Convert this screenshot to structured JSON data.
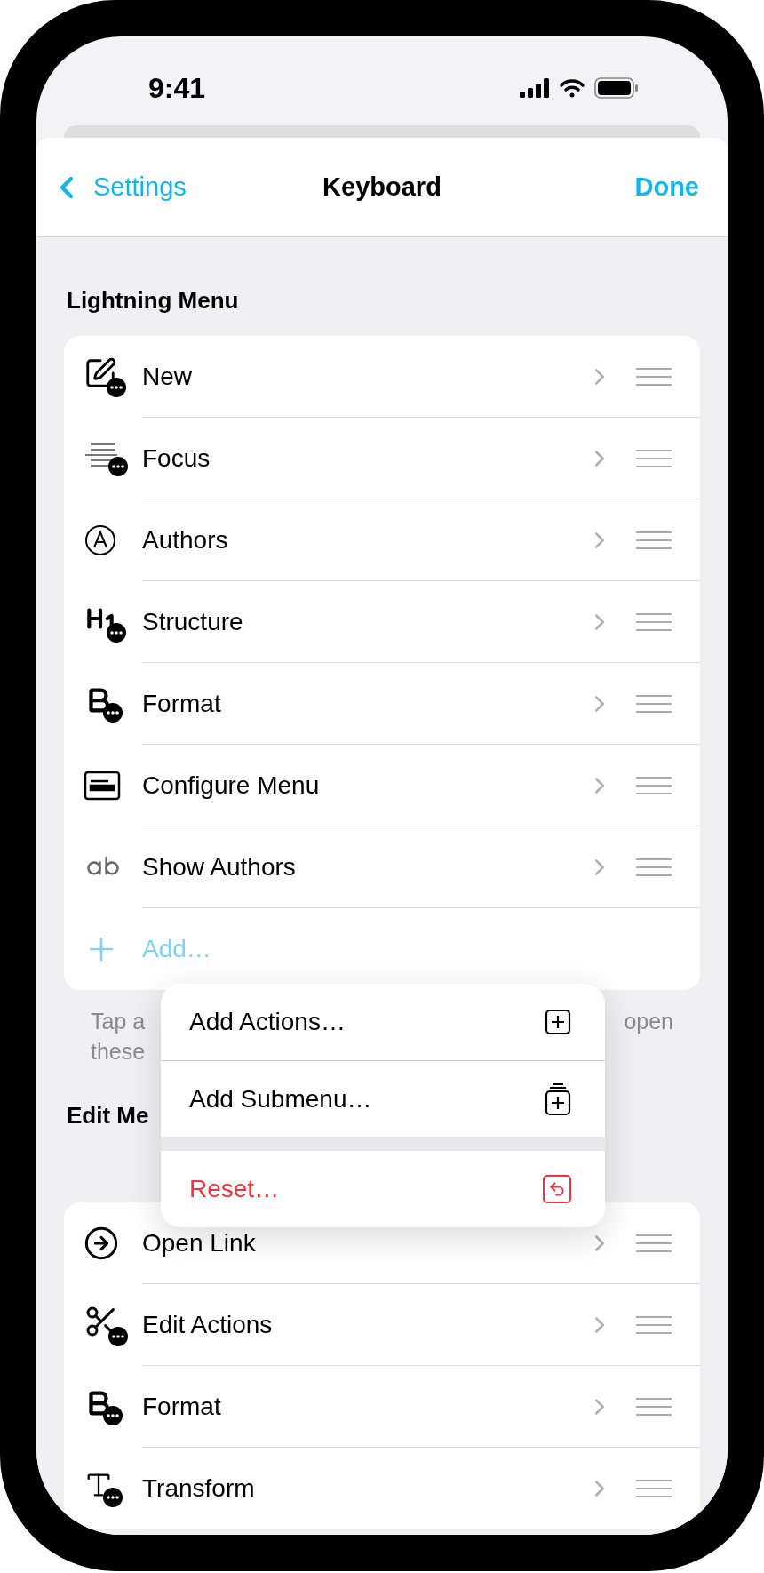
{
  "status_bar": {
    "time": "9:41"
  },
  "nav": {
    "back": "Settings",
    "title": "Keyboard",
    "done": "Done"
  },
  "sections": [
    {
      "header": "Lightning Menu",
      "items": [
        {
          "label": "New"
        },
        {
          "label": "Focus"
        },
        {
          "label": "Authors"
        },
        {
          "label": "Structure"
        },
        {
          "label": "Format"
        },
        {
          "label": "Configure Menu"
        },
        {
          "label": "Show Authors"
        }
      ],
      "add": "Add…",
      "footer": [
        "Tap a",
        "open",
        "these"
      ]
    },
    {
      "header": "Edit Me",
      "items": [
        {
          "label": "Open Link"
        },
        {
          "label": "Edit Actions"
        },
        {
          "label": "Format"
        },
        {
          "label": "Transform"
        }
      ]
    }
  ],
  "popup_menu": {
    "groups": [
      [
        {
          "label": "Add Actions…",
          "kind": "add"
        },
        {
          "label": "Add Submenu…",
          "kind": "submenu"
        }
      ],
      [
        {
          "label": "Reset…",
          "kind": "destructive"
        }
      ]
    ]
  }
}
